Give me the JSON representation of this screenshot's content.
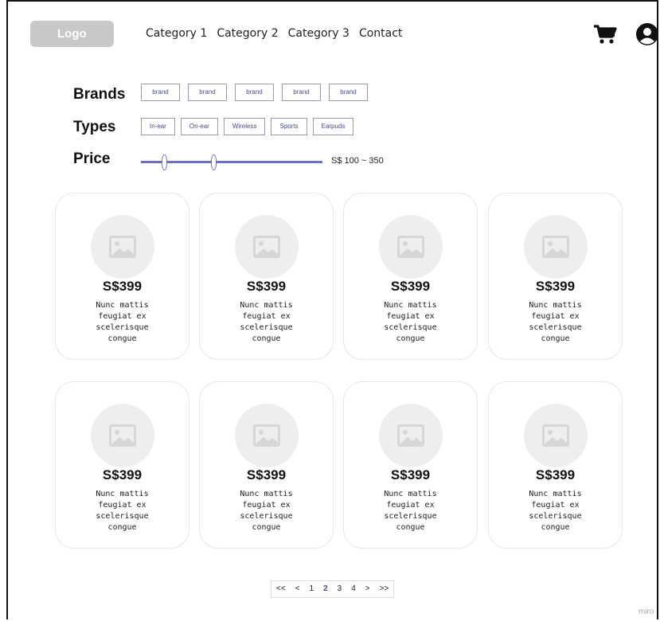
{
  "header": {
    "logo": "Logo",
    "nav": [
      "Category 1",
      "Category 2",
      "Category 3",
      "Contact"
    ],
    "icons": {
      "cart": "cart-icon",
      "user": "user-icon"
    }
  },
  "filters": {
    "brands_label": "Brands",
    "brands": [
      "brand",
      "brand",
      "brand",
      "brand",
      "brand"
    ],
    "types_label": "Types",
    "types": [
      "In-ear",
      "On-ear",
      "Wireless",
      "Sports",
      "Earpuds"
    ],
    "price_label": "Price",
    "price_range_text": "S$ 100 ~ 350",
    "accent_color": "#6c6fc9"
  },
  "products": [
    {
      "price": "S$399",
      "desc": "Nunc mattis\nfeugiat ex\nscelerisque\ncongue"
    },
    {
      "price": "S$399",
      "desc": "Nunc mattis\nfeugiat ex\nscelerisque\ncongue"
    },
    {
      "price": "S$399",
      "desc": "Nunc mattis\nfeugiat ex\nscelerisque\ncongue"
    },
    {
      "price": "S$399",
      "desc": "Nunc mattis\nfeugiat ex\nscelerisque\ncongue"
    },
    {
      "price": "S$399",
      "desc": "Nunc mattis\nfeugiat ex\nscelerisque\ncongue"
    },
    {
      "price": "S$399",
      "desc": "Nunc mattis\nfeugiat ex\nscelerisque\ncongue"
    },
    {
      "price": "S$399",
      "desc": "Nunc mattis\nfeugiat ex\nscelerisque\ncongue"
    },
    {
      "price": "S$399",
      "desc": "Nunc mattis\nfeugiat ex\nscelerisque\ncongue"
    }
  ],
  "pagination": {
    "items": [
      "<<",
      "<",
      "1",
      "2",
      "3",
      "4",
      ">",
      ">>"
    ],
    "current": "2"
  },
  "watermark": "miro"
}
